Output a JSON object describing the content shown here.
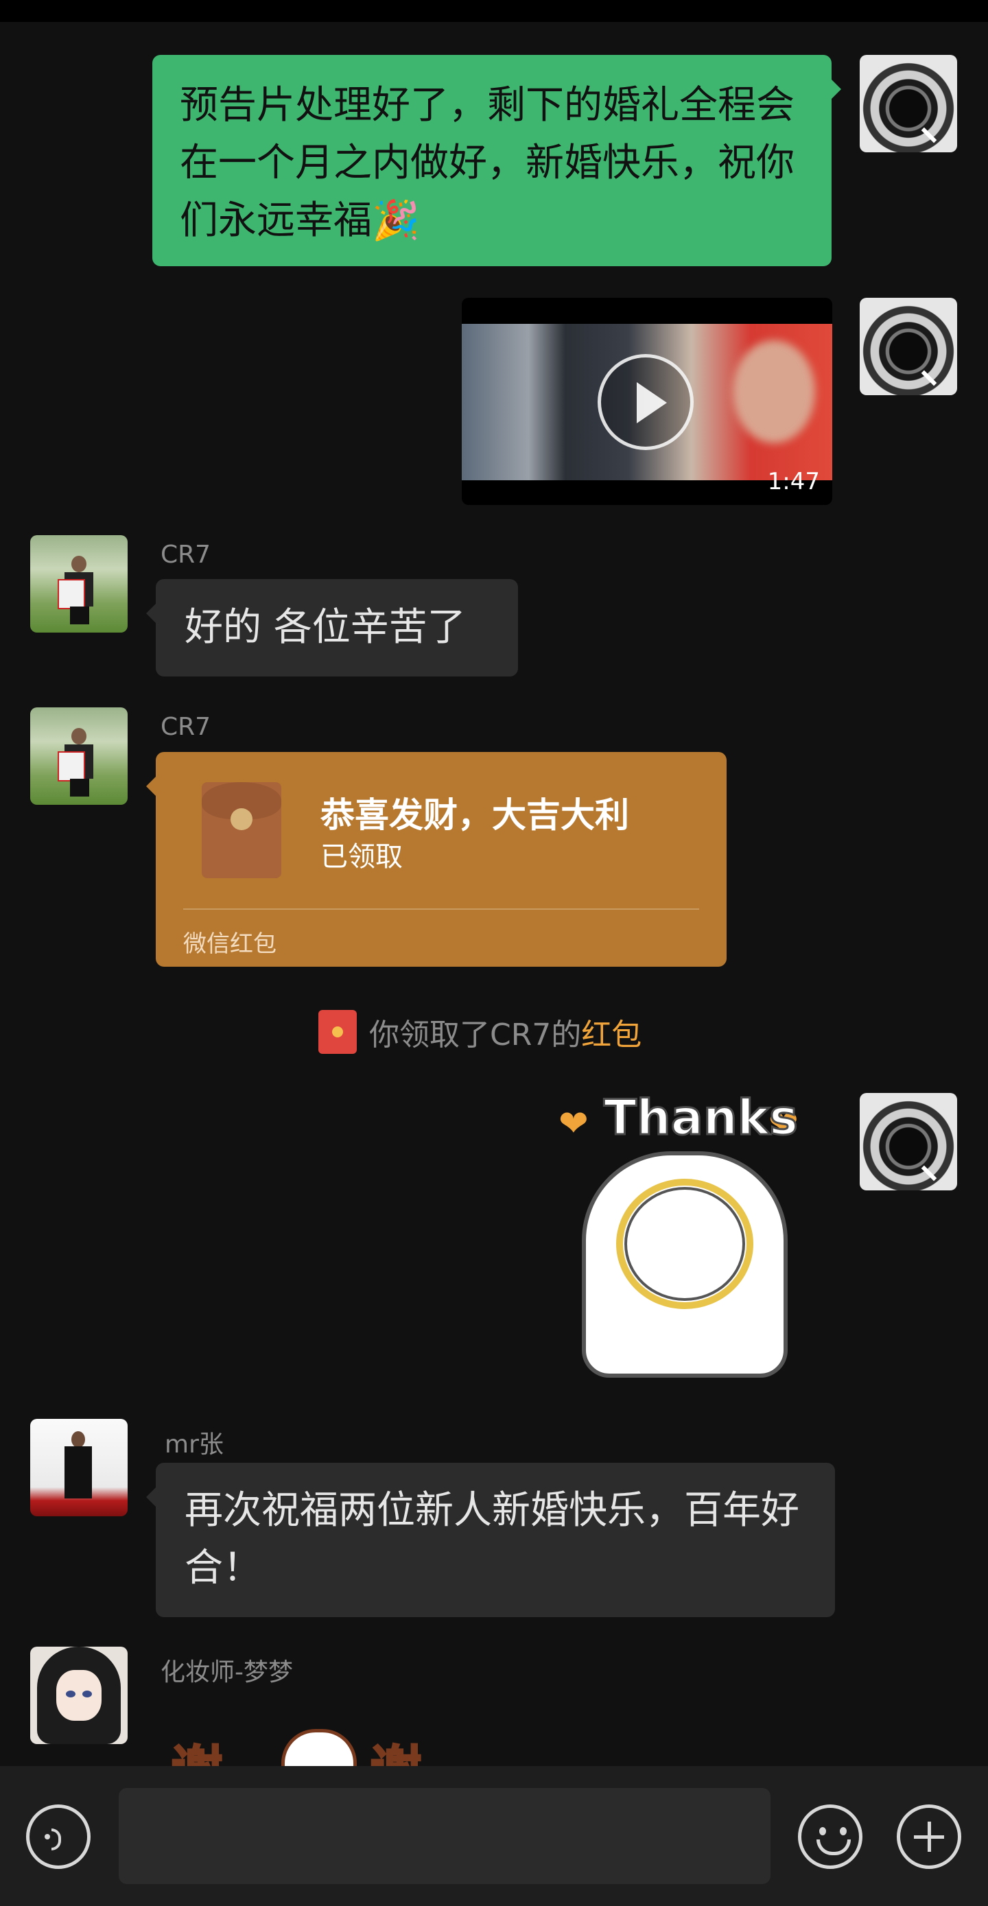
{
  "messages": {
    "m1": {
      "text": "预告片处理好了，剩下的婚礼全程会在一个月之内做好，新婚快乐，祝你们永远幸福🎉"
    },
    "m2": {
      "video_duration": "1:47"
    },
    "m3": {
      "sender": "CR7",
      "text": "好的 各位辛苦了"
    },
    "m4": {
      "sender": "CR7",
      "packet_title": "恭喜发财，大吉大利",
      "packet_status": "已领取",
      "packet_footer": "微信红包"
    },
    "notice": {
      "prefix": "你领取了CR7的",
      "link": "红包"
    },
    "m5": {
      "sticker_text": "Thanks"
    },
    "m6": {
      "sender": "mr张",
      "text": "再次祝福两位新人新婚快乐，百年好合！"
    },
    "m7": {
      "sender": "化妆师-梦梦",
      "sticker_text": "谢"
    }
  },
  "input": {
    "value": "",
    "placeholder": ""
  },
  "icons": {
    "voice": "voice-icon",
    "emoji": "emoji-icon",
    "plus": "plus-icon",
    "play": "play-icon",
    "red_packet": "red-packet-icon"
  },
  "colors": {
    "background": "#111111",
    "self_bubble": "#3fb66f",
    "other_bubble": "#2c2c2c",
    "packet": "#b7792f",
    "link": "#f0a43a"
  }
}
